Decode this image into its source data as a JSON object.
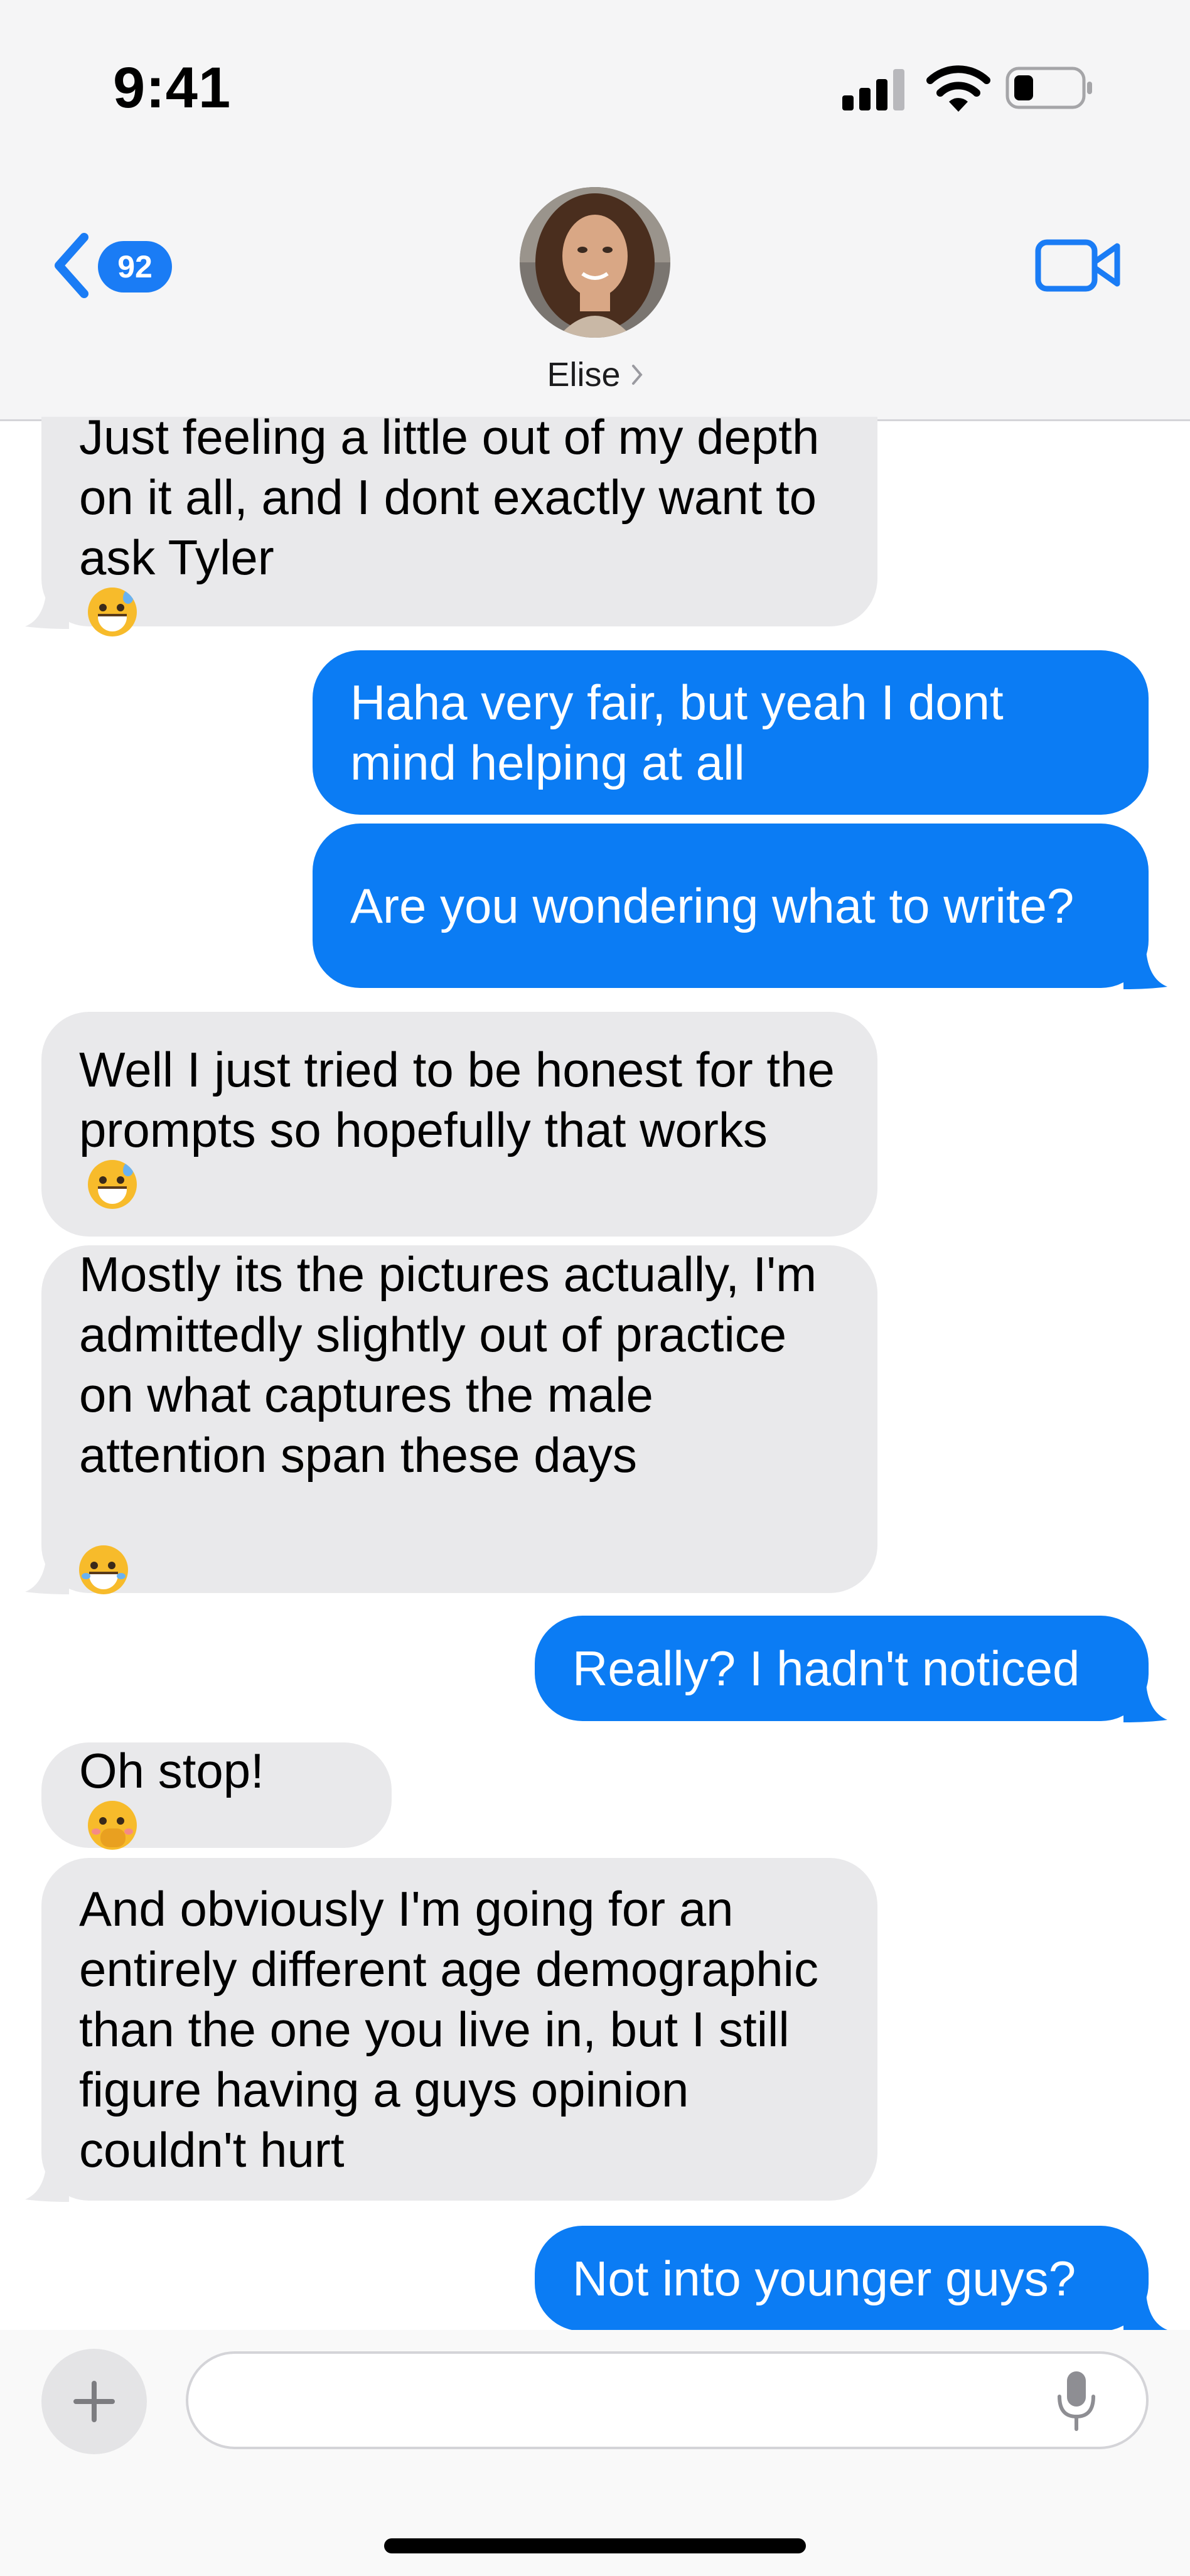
{
  "status_bar": {
    "time": "9:41"
  },
  "header": {
    "back_badge_count": "92",
    "contact_name": "Elise"
  },
  "messages": [
    {
      "side": "in",
      "text": "Just feeling a little out of my depth on it all, and I dont exactly want to ask Tyler",
      "emoji": "grinning-sweat-emoji"
    },
    {
      "side": "out",
      "text": "Haha very fair, but yeah I dont mind helping at all"
    },
    {
      "side": "out",
      "text": "Are you wondering what to write?"
    },
    {
      "side": "in",
      "text": "Well I just tried to be honest for the prompts so hopefully that works",
      "emoji": "grinning-sweat-emoji"
    },
    {
      "side": "in",
      "text": "Mostly its the pictures actually, I'm admittedly slightly out of practice on what captures the male attention span these days",
      "emoji": "tears-of-joy-emoji"
    },
    {
      "side": "out",
      "text": "Really? I hadn't noticed"
    },
    {
      "side": "in",
      "text": "Oh stop!",
      "emoji": "hand-over-mouth-emoji"
    },
    {
      "side": "in",
      "text": "And obviously I'm going for an entirely different age demographic than the one you live in, but I still figure having a guys opinion couldn't hurt"
    },
    {
      "side": "out",
      "text": "Not into younger guys?"
    }
  ],
  "composer": {
    "placeholder": ""
  },
  "colors": {
    "outgoing_bubble": "#0b7cf4",
    "incoming_bubble": "#e9e9eb",
    "accent": "#1a7cf5"
  }
}
